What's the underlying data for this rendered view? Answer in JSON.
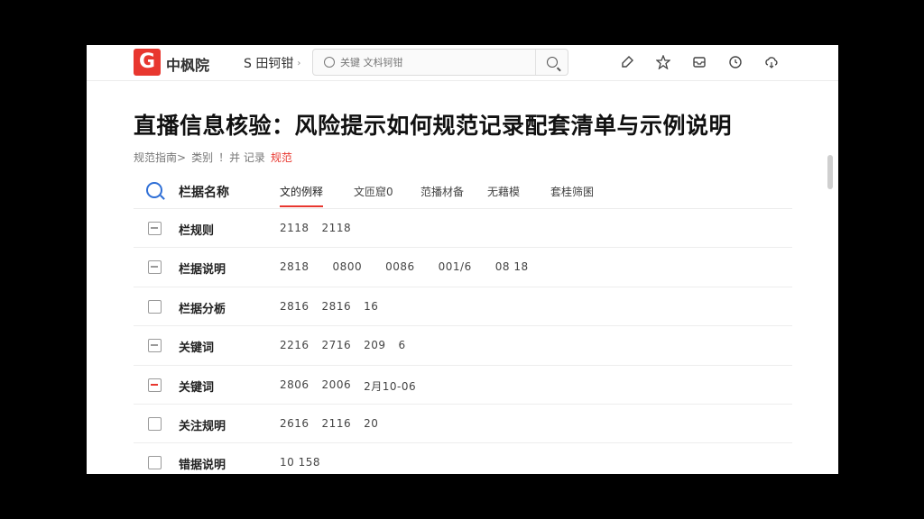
{
  "topbar": {
    "logo_letter": "G",
    "logo_text": "中枫院",
    "menu_label": "S 田钶钳",
    "menu_chevron": "›",
    "search_placeholder": "关键 文枓钶钳",
    "icons": [
      "note-icon",
      "pin-icon",
      "inbox-icon",
      "clock-icon",
      "cloud-icon"
    ]
  },
  "page": {
    "title": "直播信息核验：风险提示如何规范记录配套清单与示例说明",
    "breadcrumb": [
      "规范指南>",
      "类别",
      "！并 记录"
    ],
    "breadcrumb_current": "规范"
  },
  "tabs": {
    "header_label": "栏据名称",
    "items": [
      {
        "label": "文的例释",
        "active": true
      },
      {
        "label": "文匝窟0",
        "active": false
      },
      {
        "label": "范播材备",
        "active": false
      },
      {
        "label": "无藉模",
        "active": false
      },
      {
        "label": "套桂筛囷",
        "active": false
      }
    ]
  },
  "rows": [
    {
      "name": "栏规则",
      "values": [
        "2118",
        "2118"
      ],
      "checkbox": "partial"
    },
    {
      "name": "栏据说明",
      "values": [
        "2818",
        "0800",
        "0086",
        "001/6",
        "08 18"
      ],
      "checkbox": "partial"
    },
    {
      "name": "栏据分栃",
      "values": [
        "2816",
        "2816",
        "16"
      ],
      "checkbox": "empty"
    },
    {
      "name": "关键词",
      "values": [
        "2216",
        "2716",
        "209",
        "6"
      ],
      "checkbox": "partial"
    },
    {
      "name": "关键词",
      "values": [
        "2806",
        "2006",
        "2月10-06"
      ],
      "checkbox": "marked"
    },
    {
      "name": "关注规明",
      "values": [
        "2616",
        "2116",
        "20"
      ],
      "checkbox": "empty"
    },
    {
      "name": "错据说明",
      "values": [
        "10 158"
      ],
      "checkbox": "empty"
    }
  ],
  "colors": {
    "brand": "#e8372f",
    "accent_blue": "#2f6fd6"
  }
}
